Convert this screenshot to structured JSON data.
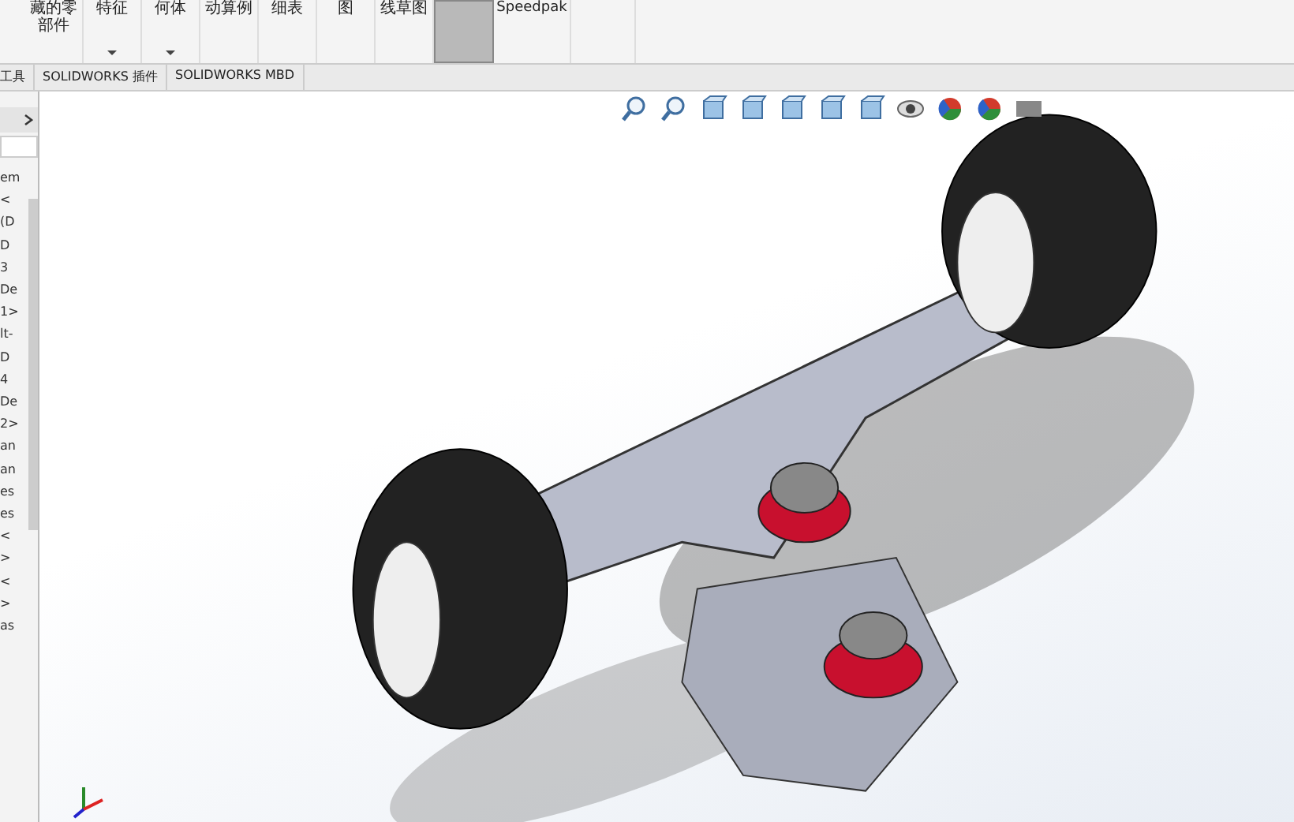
{
  "ribbon": {
    "buttons": [
      {
        "lines": [
          "藏的零",
          "部件"
        ],
        "dropdown": false,
        "selected": false
      },
      {
        "lines": [
          "特征"
        ],
        "dropdown": true,
        "selected": false
      },
      {
        "lines": [
          "何体"
        ],
        "dropdown": true,
        "selected": false
      },
      {
        "lines": [
          "动算例"
        ],
        "dropdown": false,
        "selected": false
      },
      {
        "lines": [
          "细表"
        ],
        "dropdown": false,
        "selected": false
      },
      {
        "lines": [
          "图"
        ],
        "dropdown": false,
        "selected": false
      },
      {
        "lines": [
          "线草图"
        ],
        "dropdown": false,
        "selected": false
      },
      {
        "dropdown": false,
        "selected": true
      },
      {
        "lines": [
          "Speedpak"
        ],
        "dropdown": false,
        "selected": false
      },
      {
        "dropdown": false,
        "selected": false
      }
    ]
  },
  "tabs": [
    {
      "label": "工具",
      "selected": false
    },
    {
      "label": "SOLIDWORKS 插件",
      "selected": false
    },
    {
      "label": "SOLIDWORKS MBD",
      "selected": false
    }
  ],
  "tree": {
    "items": [
      "em",
      "<",
      "(D",
      "D",
      "3",
      "De",
      "1>",
      "lt-",
      "D",
      "4",
      "De",
      "2>",
      "an",
      "an",
      "es",
      "es",
      "<",
      ">",
      "<",
      ">",
      "as"
    ]
  }
}
